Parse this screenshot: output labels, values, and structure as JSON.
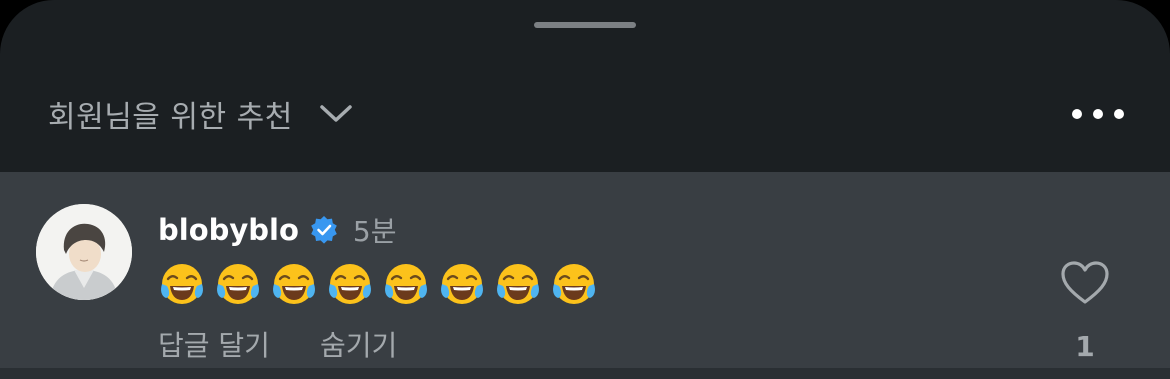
{
  "header": {
    "title": "회원님을 위한 추천"
  },
  "comment": {
    "username": "blobyblo",
    "time": "5분",
    "emoji_icon": "face-with-tears-of-joy",
    "emoji_count": 8,
    "reply_label": "답글 달기",
    "hide_label": "숨기기",
    "like_count": "1"
  },
  "colors": {
    "sheet_bg": "#1b1f22",
    "comment_bg": "#393e43",
    "verified_blue": "#3897f0",
    "secondary_text": "#a4a9ad"
  }
}
